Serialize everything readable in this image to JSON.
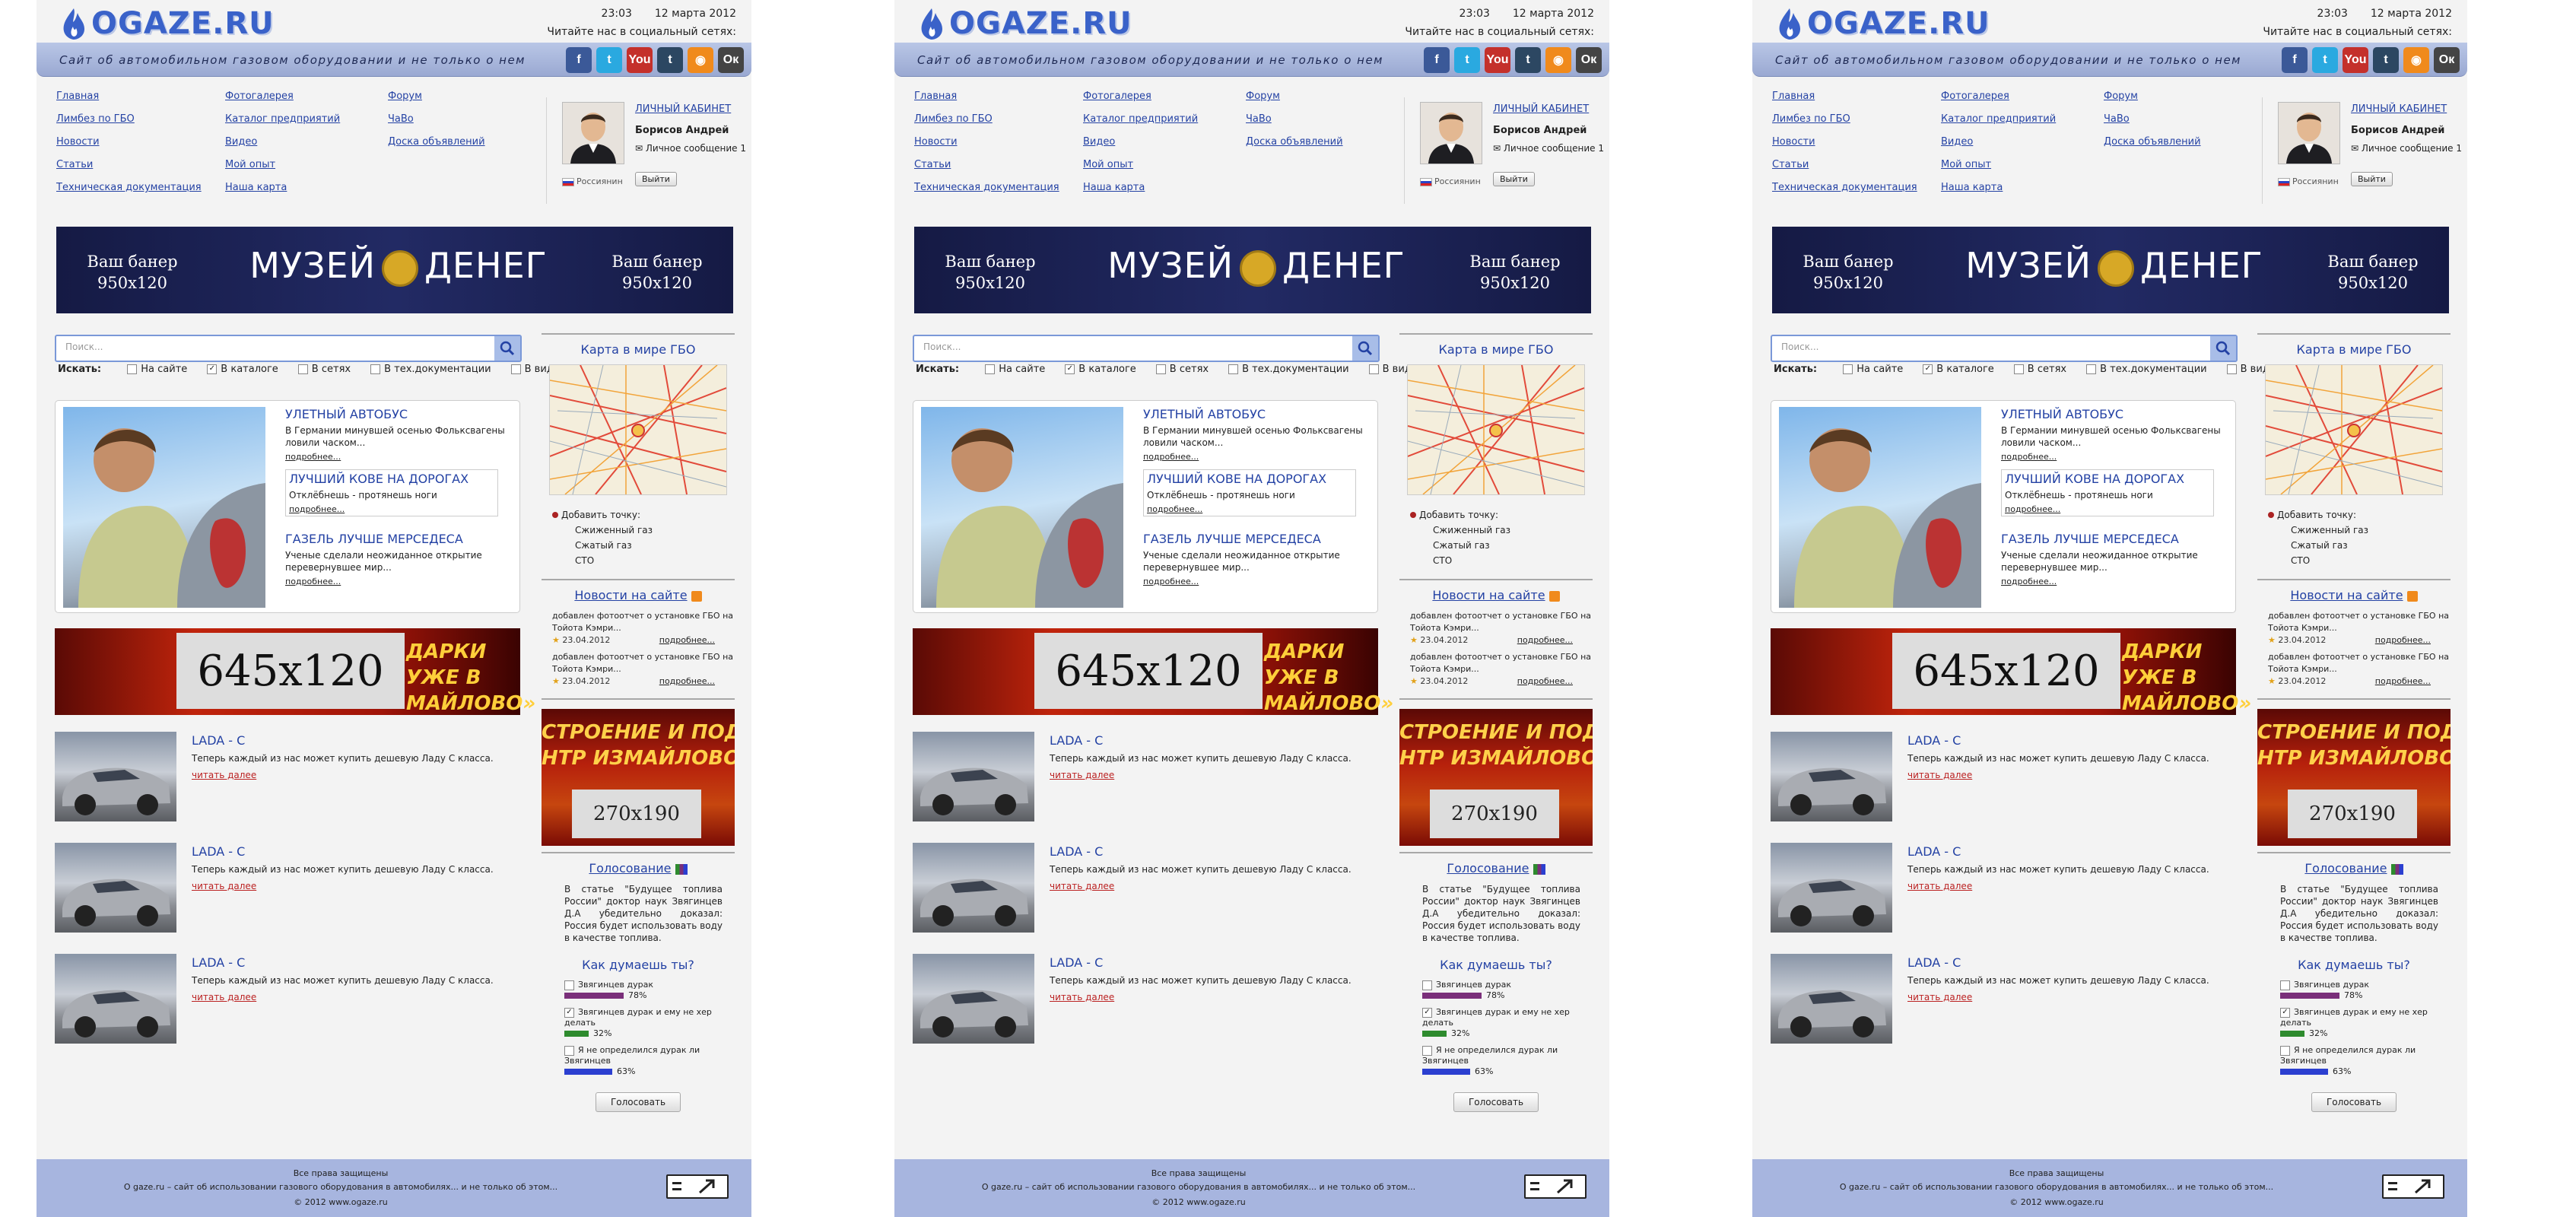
{
  "site": {
    "logo_text": "OGAZE.RU",
    "time": "23:03",
    "date": "12 марта 2012",
    "read_us": "Читайте нас в социальный сетях:",
    "tagline": "Сайт об автомобильном газовом оборудовании и не только о нем"
  },
  "socials": [
    {
      "icon": "facebook-icon",
      "label": "f",
      "color": "#3b5998"
    },
    {
      "icon": "twitter-icon",
      "label": "t",
      "color": "#2aa9e0"
    },
    {
      "icon": "youtube-icon",
      "label": "You",
      "color": "#c4302b"
    },
    {
      "icon": "tumblr-icon",
      "label": "t",
      "color": "#2c4762"
    },
    {
      "icon": "rss-icon",
      "label": "◉",
      "color": "#f08a1c"
    },
    {
      "icon": "odnoklassniki-icon",
      "label": "Ок",
      "color": "#444444"
    }
  ],
  "nav": {
    "col1": [
      "Главная",
      "Лимбез по ГБО",
      "Новости",
      "Статьи",
      "Техническая документация"
    ],
    "col2": [
      "Фотогалерея",
      "Каталог предприятий",
      "Видео",
      "Мой опыт",
      "Наша карта"
    ],
    "col3": [
      "Форум",
      "ЧаВо",
      "Доска объявлений"
    ]
  },
  "user": {
    "cabinet": "ЛИЧНЫЙ КАБИНЕТ",
    "name": "Борисов Андрей",
    "message": "Личное сообщение 1",
    "role": "Россиянин",
    "logout": "Выйти"
  },
  "banner": {
    "left": "Ваш банер\n950x120",
    "center": "МУЗЕЙ ДЕНЕГ",
    "right": "Ваш банер\n950x120"
  },
  "search": {
    "placeholder": "Поиск...",
    "label": "Искать:",
    "filters": [
      {
        "label": "На сайте",
        "checked": false
      },
      {
        "label": "В каталоге",
        "checked": true
      },
      {
        "label": "В сетях",
        "checked": false
      },
      {
        "label": "В тех.документации",
        "checked": false
      },
      {
        "label": "В видео",
        "checked": false
      }
    ]
  },
  "featured": [
    {
      "title": "УЛЕТНЫЙ АВТОБУС",
      "desc": "В Германии минувшей осенью Фольксвагены ловили часком...",
      "more": "подробнее..."
    },
    {
      "title": "ЛУЧШИЙ КОВЕ НА ДОРОГАХ",
      "desc": "Отклёбнешь - протянешь ноги",
      "more": "подробнее..."
    },
    {
      "title": "ГАЗЕЛЬ ЛУЧШЕ МЕРСЕДЕСА",
      "desc": "Ученые сделали неожиданное открытие перевернувшее мир...",
      "more": "подробнее..."
    }
  ],
  "ad645": {
    "size": "645x120",
    "slogan": "ДАРКИ УЖЕ В\nМАЙЛОВО»"
  },
  "news_list": [
    {
      "title": "LADA - C",
      "desc": "Теперь каждый из нас может купить дешевую Ладу С класса.",
      "read": "читать далее"
    },
    {
      "title": "LADA - C",
      "desc": "Теперь каждый из нас может купить дешевую Ладу С класса.",
      "read": "читать далее"
    },
    {
      "title": "LADA - C",
      "desc": "Теперь каждый из нас может купить дешевую Ладу С класса.",
      "read": "читать далее"
    }
  ],
  "right": {
    "map_title": "Карта в мире ГБО",
    "add_point": "Добавить точку:",
    "point_types": [
      "Сжиженный газ",
      "Сжатый газ",
      "СТО"
    ],
    "news_title": "Новости на сайте",
    "site_news": [
      {
        "text": "добавлен фотоотчет о установке ГБО на Тойота Кэмри...",
        "date": "23.04.2012",
        "more": "подробнее..."
      },
      {
        "text": "добавлен фотоотчет о установке ГБО на Тойота Кэмри...",
        "date": "23.04.2012",
        "more": "подробнее..."
      }
    ],
    "ad270": {
      "size": "270x190",
      "slogan": "СТРОЕНИЕ И ПОДАРКИ УЖЕ В\nНТР ИЗМАЙЛОВО»"
    },
    "poll_title": "Голосование",
    "poll_text": "В статье \"Будущее топлива России\" доктор наук Звягинцев Д.А убедительно доказал: Россия будет использовать воду в качестве топлива.",
    "poll_question": "Как думаешь ты?",
    "options": [
      {
        "label": "Звягинцев дурак",
        "pct": "78%",
        "value": 78,
        "color": "#7a2f7a",
        "checked": false
      },
      {
        "label": "Звягинцев дурак и ему не хер делать",
        "pct": "32%",
        "value": 32,
        "color": "#2e8b2e",
        "checked": true
      },
      {
        "label": "Я не определился дурак ли Звягинцев",
        "pct": "63%",
        "value": 63,
        "color": "#2b3fd0",
        "checked": false
      }
    ],
    "vote": "Голосовать"
  },
  "footer": {
    "line1": "Все права защищены",
    "line2": "О gaze.ru – сайт об использовании газового оборудования в автомобилях... и не только об этом...",
    "line3": "© 2012 www.ogaze.ru"
  }
}
